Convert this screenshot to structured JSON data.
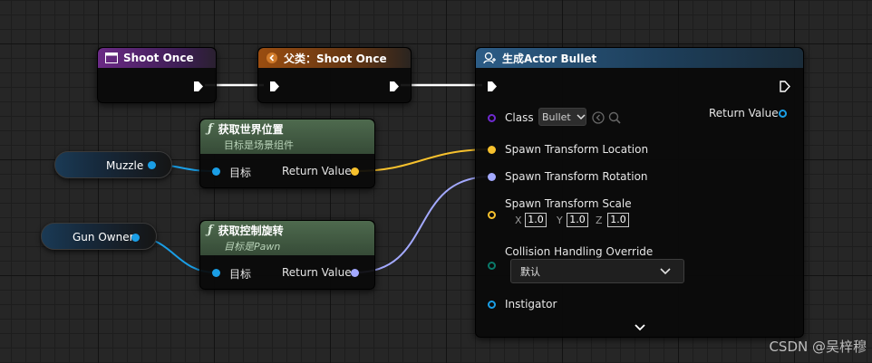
{
  "colors": {
    "exec": "#ffffff",
    "vector": "#f7c12d",
    "rotator": "#a3a9ff",
    "object": "#1a9ee6",
    "class": "#6f2ad0",
    "struct": "#0a7a6a"
  },
  "nodes": {
    "shoot_once": {
      "title": "Shoot Once",
      "icon": "event-box-icon"
    },
    "parent_shoot": {
      "title": "父类：Shoot Once",
      "icon": "parent-call-icon"
    },
    "get_world_location": {
      "title": "获取世界位置",
      "subtitle": "目标是场景组件",
      "target": "目标",
      "return": "Return Value"
    },
    "get_control_rotation": {
      "title": "获取控制旋转",
      "subtitle": "目标是Pawn",
      "target": "目标",
      "return": "Return Value"
    },
    "spawn_actor": {
      "title": "生成Actor Bullet",
      "icon": "spawn-actor-icon",
      "class_label": "Class",
      "class_value": "Bullet",
      "return": "Return Value",
      "location": "Spawn Transform Location",
      "rotation": "Spawn Transform Rotation",
      "scale": "Spawn Transform Scale",
      "scale_x_label": "X",
      "scale_x": "1.0",
      "scale_y_label": "Y",
      "scale_y": "1.0",
      "scale_z_label": "Z",
      "scale_z": "1.0",
      "collision": "Collision Handling Override",
      "collision_value": "默认",
      "instigator": "Instigator"
    }
  },
  "variables": {
    "muzzle": "Muzzle",
    "gun_owner": "Gun Owner"
  },
  "watermark": "CSDN @吴梓穆"
}
